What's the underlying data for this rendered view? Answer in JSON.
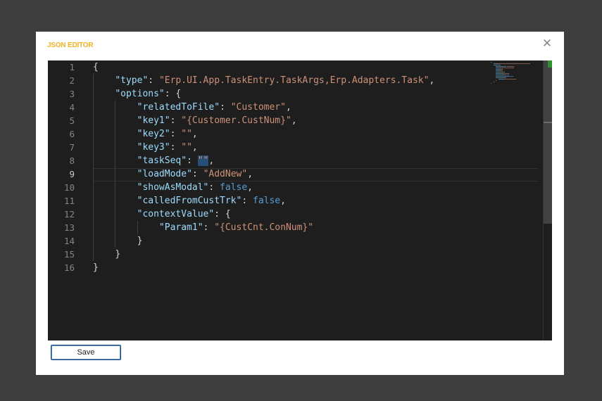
{
  "dialog": {
    "title": "JSON EDITOR",
    "close_glyph": "✕",
    "save_label": "Save",
    "title_color": "#f0b429",
    "accent_border": "#1e4f86"
  },
  "editor": {
    "active_line": 9,
    "lines": [
      {
        "n": "1",
        "tokens": [
          {
            "t": "{",
            "c": "p"
          }
        ]
      },
      {
        "n": "2",
        "tokens": [
          {
            "t": "    ",
            "c": "p"
          },
          {
            "t": "\"type\"",
            "c": "k"
          },
          {
            "t": ": ",
            "c": "p"
          },
          {
            "t": "\"Erp.UI.App.TaskEntry.TaskArgs,Erp.Adapters.Task\"",
            "c": "s"
          },
          {
            "t": ",",
            "c": "p"
          }
        ]
      },
      {
        "n": "3",
        "tokens": [
          {
            "t": "    ",
            "c": "p"
          },
          {
            "t": "\"options\"",
            "c": "k"
          },
          {
            "t": ": {",
            "c": "p"
          }
        ]
      },
      {
        "n": "4",
        "tokens": [
          {
            "t": "        ",
            "c": "p"
          },
          {
            "t": "\"relatedToFile\"",
            "c": "k"
          },
          {
            "t": ": ",
            "c": "p"
          },
          {
            "t": "\"Customer\"",
            "c": "s"
          },
          {
            "t": ",",
            "c": "p"
          }
        ]
      },
      {
        "n": "5",
        "tokens": [
          {
            "t": "        ",
            "c": "p"
          },
          {
            "t": "\"key1\"",
            "c": "k"
          },
          {
            "t": ": ",
            "c": "p"
          },
          {
            "t": "\"{Customer.CustNum}\"",
            "c": "s"
          },
          {
            "t": ",",
            "c": "p"
          }
        ]
      },
      {
        "n": "6",
        "tokens": [
          {
            "t": "        ",
            "c": "p"
          },
          {
            "t": "\"key2\"",
            "c": "k"
          },
          {
            "t": ": ",
            "c": "p"
          },
          {
            "t": "\"\"",
            "c": "s"
          },
          {
            "t": ",",
            "c": "p"
          }
        ]
      },
      {
        "n": "7",
        "tokens": [
          {
            "t": "        ",
            "c": "p"
          },
          {
            "t": "\"key3\"",
            "c": "k"
          },
          {
            "t": ": ",
            "c": "p"
          },
          {
            "t": "\"\"",
            "c": "s"
          },
          {
            "t": ",",
            "c": "p"
          }
        ]
      },
      {
        "n": "8",
        "tokens": [
          {
            "t": "        ",
            "c": "p"
          },
          {
            "t": "\"taskSeq\"",
            "c": "k"
          },
          {
            "t": ": ",
            "c": "p"
          },
          {
            "t": "\"\"",
            "c": "s sel"
          },
          {
            "t": ",",
            "c": "p"
          }
        ]
      },
      {
        "n": "9",
        "tokens": [
          {
            "t": "        ",
            "c": "p"
          },
          {
            "t": "\"loadMode\"",
            "c": "k"
          },
          {
            "t": ": ",
            "c": "p"
          },
          {
            "t": "\"AddNew\"",
            "c": "s"
          },
          {
            "t": ",",
            "c": "p"
          }
        ]
      },
      {
        "n": "10",
        "tokens": [
          {
            "t": "        ",
            "c": "p"
          },
          {
            "t": "\"showAsModal\"",
            "c": "k"
          },
          {
            "t": ": ",
            "c": "p"
          },
          {
            "t": "false",
            "c": "b"
          },
          {
            "t": ",",
            "c": "p"
          }
        ]
      },
      {
        "n": "11",
        "tokens": [
          {
            "t": "        ",
            "c": "p"
          },
          {
            "t": "\"calledFromCustTrk\"",
            "c": "k"
          },
          {
            "t": ": ",
            "c": "p"
          },
          {
            "t": "false",
            "c": "b"
          },
          {
            "t": ",",
            "c": "p"
          }
        ]
      },
      {
        "n": "12",
        "tokens": [
          {
            "t": "        ",
            "c": "p"
          },
          {
            "t": "\"contextValue\"",
            "c": "k"
          },
          {
            "t": ": {",
            "c": "p"
          }
        ]
      },
      {
        "n": "13",
        "tokens": [
          {
            "t": "            ",
            "c": "p"
          },
          {
            "t": "\"Param1\"",
            "c": "k"
          },
          {
            "t": ": ",
            "c": "p"
          },
          {
            "t": "\"{CustCnt.ConNum}\"",
            "c": "s"
          }
        ]
      },
      {
        "n": "14",
        "tokens": [
          {
            "t": "        ",
            "c": "p"
          },
          {
            "t": "}",
            "c": "p"
          }
        ]
      },
      {
        "n": "15",
        "tokens": [
          {
            "t": "    ",
            "c": "p"
          },
          {
            "t": "}",
            "c": "p"
          }
        ]
      },
      {
        "n": "16",
        "tokens": [
          {
            "t": "}",
            "c": "p"
          }
        ]
      }
    ]
  }
}
